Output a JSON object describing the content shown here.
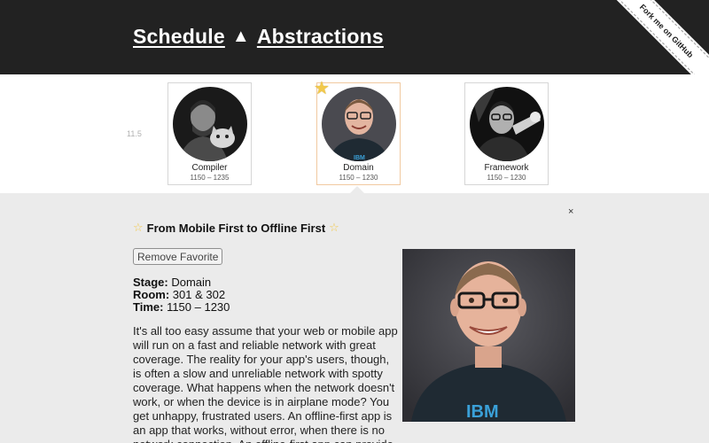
{
  "header": {
    "nav_schedule": "Schedule",
    "separator": "▲",
    "nav_abstractions": "Abstractions",
    "ribbon": "Fork me on GitHub"
  },
  "schedule": {
    "time_marker": "11.5",
    "cards": [
      {
        "stage": "Compiler",
        "time": "1150 – 1235",
        "favorite": false,
        "selected": false,
        "avatar": "speaker-compiler-photo"
      },
      {
        "stage": "Domain",
        "time": "1150 – 1230",
        "favorite": true,
        "selected": true,
        "avatar": "speaker-domain-photo"
      },
      {
        "stage": "Framework",
        "time": "1150 – 1230",
        "favorite": false,
        "selected": false,
        "avatar": "speaker-framework-photo"
      }
    ]
  },
  "detail": {
    "close": "×",
    "star": "☆",
    "title": "From Mobile First to Offline First",
    "button": "Remove Favorite",
    "stage_label": "Stage:",
    "stage": "Domain",
    "room_label": "Room:",
    "room": "301 & 302",
    "time_label": "Time:",
    "time": "1150 – 1230",
    "description": "It's all too easy assume that your web or mobile app will run on a fast and reliable network with great coverage. The reality for your app's users, though, is often a slow and unreliable network with spotty coverage. What happens when the network doesn't work, or when the device is in airplane mode? You get unhappy, frustrated users. An offline-first app is an app that works, without error, when there is no network connection. An offline-first app can provide",
    "shirt_text": "IBM"
  },
  "colors": {
    "header_bg": "#222222",
    "panel_bg": "#ebebeb",
    "favorite_star": "#f2c94c",
    "selected_border": "#f1c9a0"
  }
}
